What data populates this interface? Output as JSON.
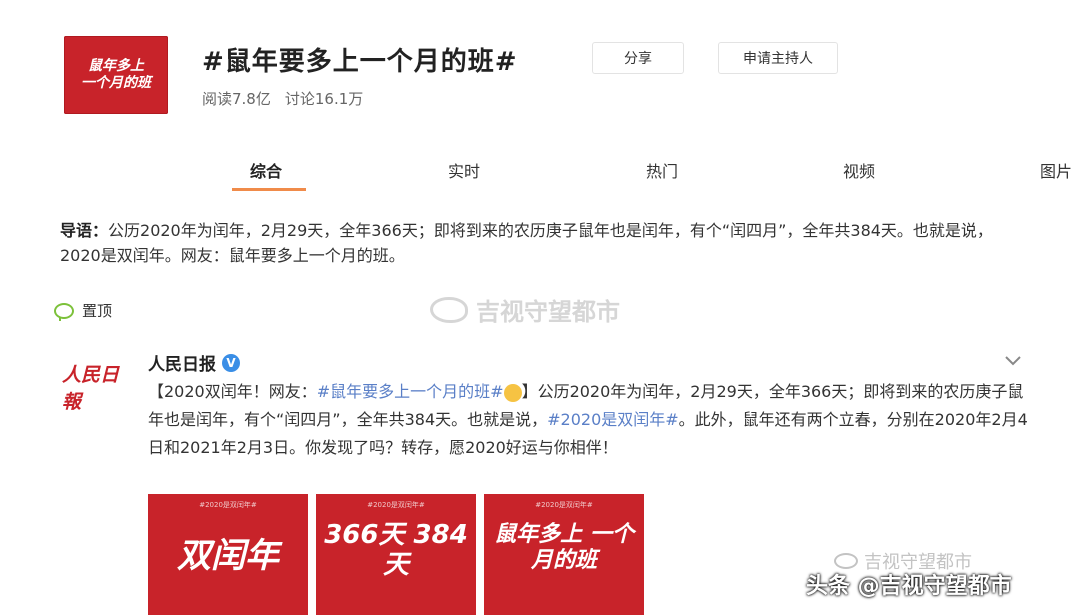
{
  "topic": {
    "cover_text_1": "鼠年多上",
    "cover_text_2": "一个月的班",
    "title": "#鼠年要多上一个月的班#",
    "share_label": "分享",
    "apply_host_label": "申请主持人",
    "reads": "阅读7.8亿",
    "discussions": "讨论16.1万"
  },
  "tabs": [
    "综合",
    "实时",
    "热门",
    "视频",
    "图片"
  ],
  "intro": {
    "label": "导语：",
    "text": "公历2020年为闰年，2月29天，全年366天；即将到来的农历庚子鼠年也是闰年，有个“闰四月”，全年共384天。也就是说，2020是双闰年。网友：鼠年要多上一个月的班。"
  },
  "pinned_label": "置顶",
  "watermark": "吉视守望都市",
  "post": {
    "avatar_text": "人民日報",
    "author": "人民日报",
    "verified_mark": "V",
    "text_1": "【2020双闰年！网友：",
    "tag_1": "#鼠年要多上一个月的班#",
    "text_2": "】公历2020年为闰年，2月29天，全年366天；即将到来的农历庚子鼠年也是闰年，有个“闰四月”，全年共384天。也就是说，",
    "tag_2": "#2020是双闰年#",
    "text_3": "。此外，鼠年还有两个立春，分别在2020年2月4日和2021年2月3日。你发现了吗？转存，愿2020好运与你相伴！"
  },
  "images": [
    {
      "tag": "#2020是双闰年#",
      "big": "双闰年"
    },
    {
      "tag": "#2020是双闰年#",
      "big": "366天 384天"
    },
    {
      "tag": "#2020是双闰年#",
      "big": "鼠年多上 一个月的班"
    }
  ],
  "footer_watermark": "头条 @吉视守望都市",
  "colors": {
    "accent": "#f08b4a",
    "link": "#5a7fc7",
    "brand_red": "#c8232a"
  }
}
